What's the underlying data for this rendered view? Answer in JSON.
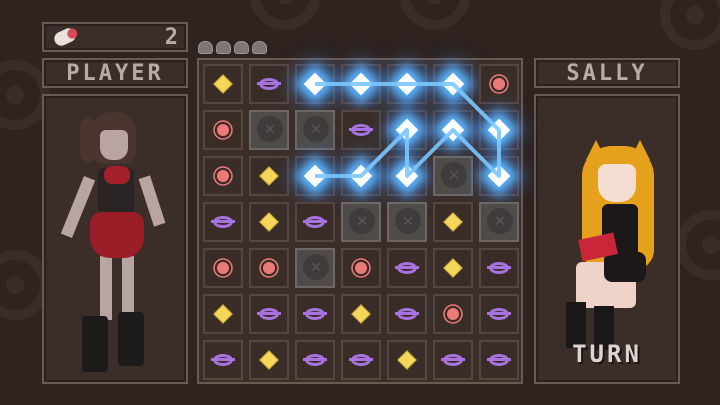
{
  "hud": {
    "score": "2",
    "score_icon": "pill-icon",
    "move_dots": 4
  },
  "players": {
    "left_label": "PLAYER",
    "right_label": "SALLY",
    "turn_label": "TURN"
  },
  "board": {
    "rows": 7,
    "cols": 7,
    "grid": [
      [
        "yellow",
        "ring",
        "glow",
        "glow",
        "glow",
        "glow",
        "sun"
      ],
      [
        "sun",
        "block",
        "block",
        "ring",
        "glow",
        "glow",
        "glow"
      ],
      [
        "sun",
        "yellow",
        "glow",
        "glow",
        "glow",
        "block",
        "glow"
      ],
      [
        "ring",
        "yellow",
        "ring",
        "block",
        "block",
        "yellow",
        "block"
      ],
      [
        "sun",
        "sun",
        "block",
        "sun",
        "ring",
        "yellow",
        "ring"
      ],
      [
        "yellow",
        "ring",
        "ring",
        "yellow",
        "ring",
        "sun",
        "ring"
      ],
      [
        "ring",
        "yellow",
        "ring",
        "ring",
        "yellow",
        "ring",
        "ring"
      ]
    ],
    "chain_path": [
      [
        0,
        2
      ],
      [
        0,
        3
      ],
      [
        0,
        4
      ],
      [
        0,
        5
      ],
      [
        1,
        6
      ],
      [
        2,
        6
      ],
      [
        1,
        5
      ],
      [
        2,
        4
      ],
      [
        1,
        4
      ],
      [
        2,
        3
      ],
      [
        2,
        2
      ]
    ],
    "colors": {
      "yellow": "#f4d65a",
      "sun": "#ec7a78",
      "ring": "#a873e0",
      "glow": "#5fb7ff",
      "block": "#4f4b49"
    }
  }
}
